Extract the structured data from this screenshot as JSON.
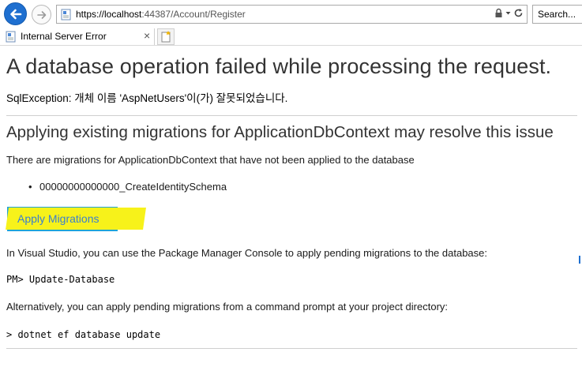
{
  "browser": {
    "url_host": "https://localhost",
    "url_rest": ":44387/Account/Register",
    "search_placeholder": "Search...",
    "tab_title": "Internal Server Error",
    "tab_close": "×"
  },
  "page": {
    "title": "A database operation failed while processing the request.",
    "exception": "SqlException: 개체 이름 'AspNetUsers'이(가) 잘못되었습니다.",
    "migrations_heading": "Applying existing migrations for ApplicationDbContext may resolve this issue",
    "migrations_intro": "There are migrations for ApplicationDbContext that have not been applied to the database",
    "pending_migrations": [
      "00000000000000_CreateIdentitySchema"
    ],
    "apply_button": "Apply Migrations",
    "vs_instructions": "In Visual Studio, you can use the Package Manager Console to apply pending migrations to the database:",
    "pm_command": "PM> Update-Database",
    "cli_instructions": "Alternatively, you can apply pending migrations from a command prompt at your project directory:",
    "cli_command": "> dotnet ef database update"
  },
  "colors": {
    "back_button": "#1e6fd0",
    "apply_button": "#20a3d8",
    "highlight": "#f7f21a"
  },
  "icons": {
    "back": "back-arrow-icon",
    "forward": "forward-arrow-icon",
    "page": "page-icon",
    "lock": "lock-icon",
    "refresh": "refresh-icon",
    "new_tab": "new-tab-icon"
  }
}
